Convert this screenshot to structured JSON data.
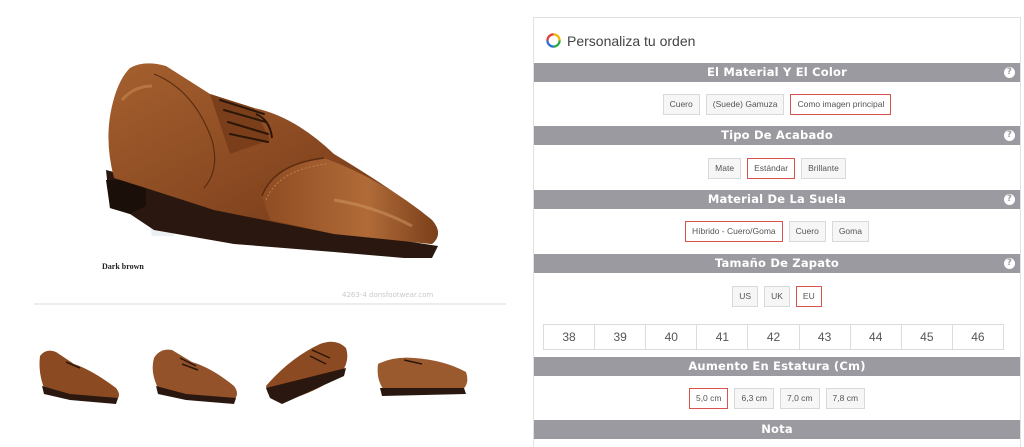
{
  "product": {
    "color_caption": "Dark brown",
    "watermark": "4263-4 donsfootwear.com"
  },
  "panel": {
    "title": "Personaliza tu orden"
  },
  "sections": {
    "material": {
      "title": "El Material Y El Color",
      "options": [
        "Cuero",
        "(Suede) Gamuza",
        "Como imagen principal"
      ],
      "selected": "Como imagen principal"
    },
    "finish": {
      "title": "Tipo De Acabado",
      "options": [
        "Mate",
        "Estándar",
        "Brillante"
      ],
      "selected": "Estándar"
    },
    "sole": {
      "title": "Material De La Suela",
      "options": [
        "Híbrido - Cuero/Goma",
        "Cuero",
        "Goma"
      ],
      "selected": "Híbrido - Cuero/Goma"
    },
    "size": {
      "title": "Tamaño De Zapato",
      "systems": [
        "US",
        "UK",
        "EU"
      ],
      "selected_system": "EU",
      "sizes": [
        "38",
        "39",
        "40",
        "41",
        "42",
        "43",
        "44",
        "45",
        "46"
      ]
    },
    "height": {
      "title": "Aumento En Estatura (Cm)",
      "options": [
        "5,0 cm",
        "6,3 cm",
        "7,0 cm",
        "7,8 cm"
      ],
      "selected": "5,0 cm"
    },
    "note": {
      "title": "Nota"
    }
  },
  "help_symbol": "?",
  "colors": {
    "section_bar": "#9b9aa0",
    "selected_border": "#d9534f",
    "leather": "#8b4a22",
    "sole": "#2a1810"
  }
}
